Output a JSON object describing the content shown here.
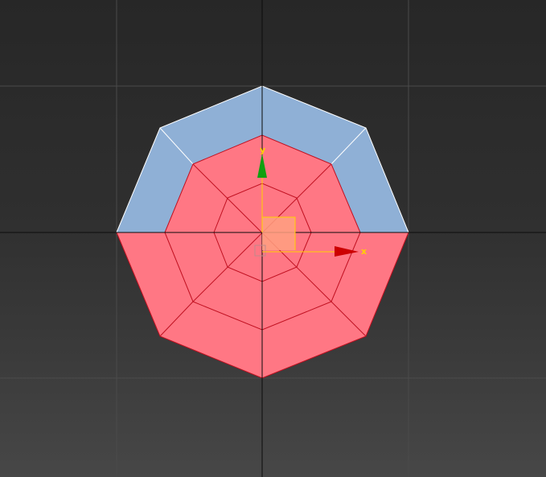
{
  "viewport": {
    "background_top": "#272727",
    "background_bottom": "#474747",
    "grid_color": "#4a4a4a",
    "world_axis_color": "#0b0b0b"
  },
  "mesh": {
    "type": "octagon-polygon-mesh",
    "rings": 3,
    "sides": 8,
    "selected_face_color": "#ff7784",
    "selected_edge_color": "#c01020",
    "unselected_face_color": "#8fb0d6",
    "unselected_edge_color": "#ffffff"
  },
  "gizmo": {
    "x_label": "x",
    "y_label": "y",
    "x_axis_color": "#cc0000",
    "y_axis_color": "#10a010",
    "plane_handle_color": "#ffa080",
    "plane_outline_color": "#ffd000",
    "label_color": "#ffd000"
  }
}
